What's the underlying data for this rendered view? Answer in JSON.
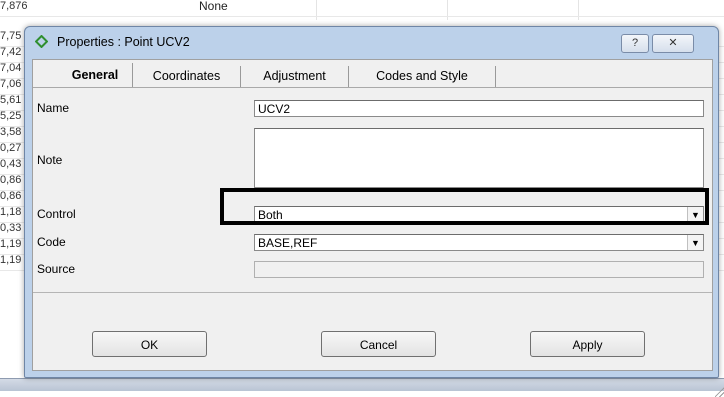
{
  "background": {
    "row_values": [
      "7,876",
      "7,75",
      "7,42",
      "7,04",
      "7,06",
      "5,61",
      "5,25",
      "3,58",
      "0,27",
      "0,43",
      "0,86",
      "0,86",
      "1,18",
      "0,33",
      "1,19",
      "1,19"
    ],
    "top_cell_text": "None"
  },
  "dialog": {
    "title": "Properties : Point UCV2",
    "help_glyph": "?",
    "close_glyph": "✕",
    "icon": "diamond-point-icon",
    "accent": "#2f8f2f"
  },
  "tabs": [
    {
      "label": "General",
      "active": true
    },
    {
      "label": "Coordinates",
      "active": false
    },
    {
      "label": "Adjustment",
      "active": false
    },
    {
      "label": "Codes and Style",
      "active": false
    }
  ],
  "form": {
    "name": {
      "label": "Name",
      "value": "UCV2"
    },
    "note": {
      "label": "Note",
      "value": ""
    },
    "control": {
      "label": "Control",
      "value": "Both"
    },
    "code": {
      "label": "Code",
      "value": "BASE,REF"
    },
    "source": {
      "label": "Source",
      "value": ""
    }
  },
  "buttons": {
    "ok": "OK",
    "cancel": "Cancel",
    "apply": "Apply"
  }
}
